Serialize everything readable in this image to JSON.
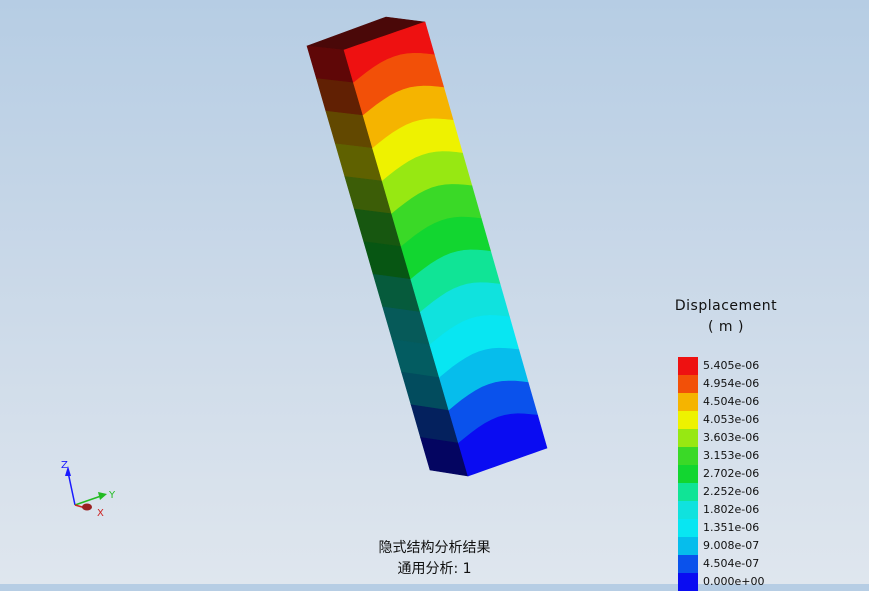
{
  "legend": {
    "title": "Displacement",
    "unit": "( m )",
    "entries": [
      {
        "value": "5.405e-06",
        "color": "#ee1111"
      },
      {
        "value": "4.954e-06",
        "color": "#f25008"
      },
      {
        "value": "4.504e-06",
        "color": "#f5b400"
      },
      {
        "value": "4.053e-06",
        "color": "#eef200"
      },
      {
        "value": "3.603e-06",
        "color": "#97e812"
      },
      {
        "value": "3.153e-06",
        "color": "#3ad927"
      },
      {
        "value": "2.702e-06",
        "color": "#12d630"
      },
      {
        "value": "2.252e-06",
        "color": "#10e496"
      },
      {
        "value": "1.802e-06",
        "color": "#10e2de"
      },
      {
        "value": "1.351e-06",
        "color": "#08e6f2"
      },
      {
        "value": "9.008e-07",
        "color": "#06bdec"
      },
      {
        "value": "4.504e-07",
        "color": "#0a52ec"
      },
      {
        "value": "0.000e+00",
        "color": "#0a0cf2"
      }
    ]
  },
  "caption": {
    "line1": "隐式结构分析结果",
    "line2": "通用分析: 1"
  },
  "triad": {
    "z_label": "Z",
    "y_label": "Y",
    "x_label": "X",
    "z_color": "#1a1aff",
    "y_color": "#22bb22",
    "x_color": "#cc2222"
  }
}
